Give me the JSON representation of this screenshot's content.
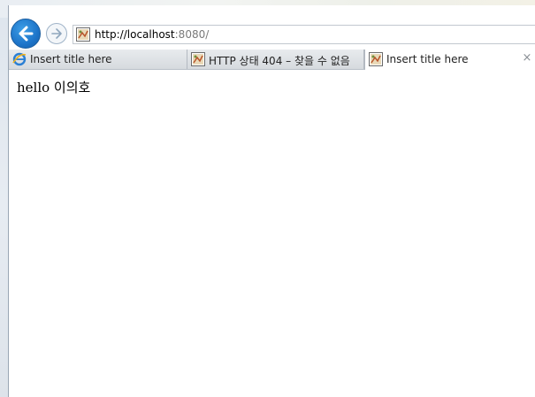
{
  "address_bar": {
    "url_host": "http://localhost",
    "url_rest": ":8080/"
  },
  "tabs": [
    {
      "label": "Insert title here",
      "icon": "ie-icon",
      "active": false
    },
    {
      "label": "HTTP 상태 404 – 찾을 수 없음",
      "icon": "page-icon",
      "active": false
    },
    {
      "label": "Insert title here",
      "icon": "page-icon",
      "active": true,
      "close": "×"
    }
  ],
  "page": {
    "body_text": "hello 이의호"
  },
  "colors": {
    "back_button": "#1d74c9",
    "tabstrip": "#dcdfe3",
    "address_border": "#c2c8cf"
  }
}
